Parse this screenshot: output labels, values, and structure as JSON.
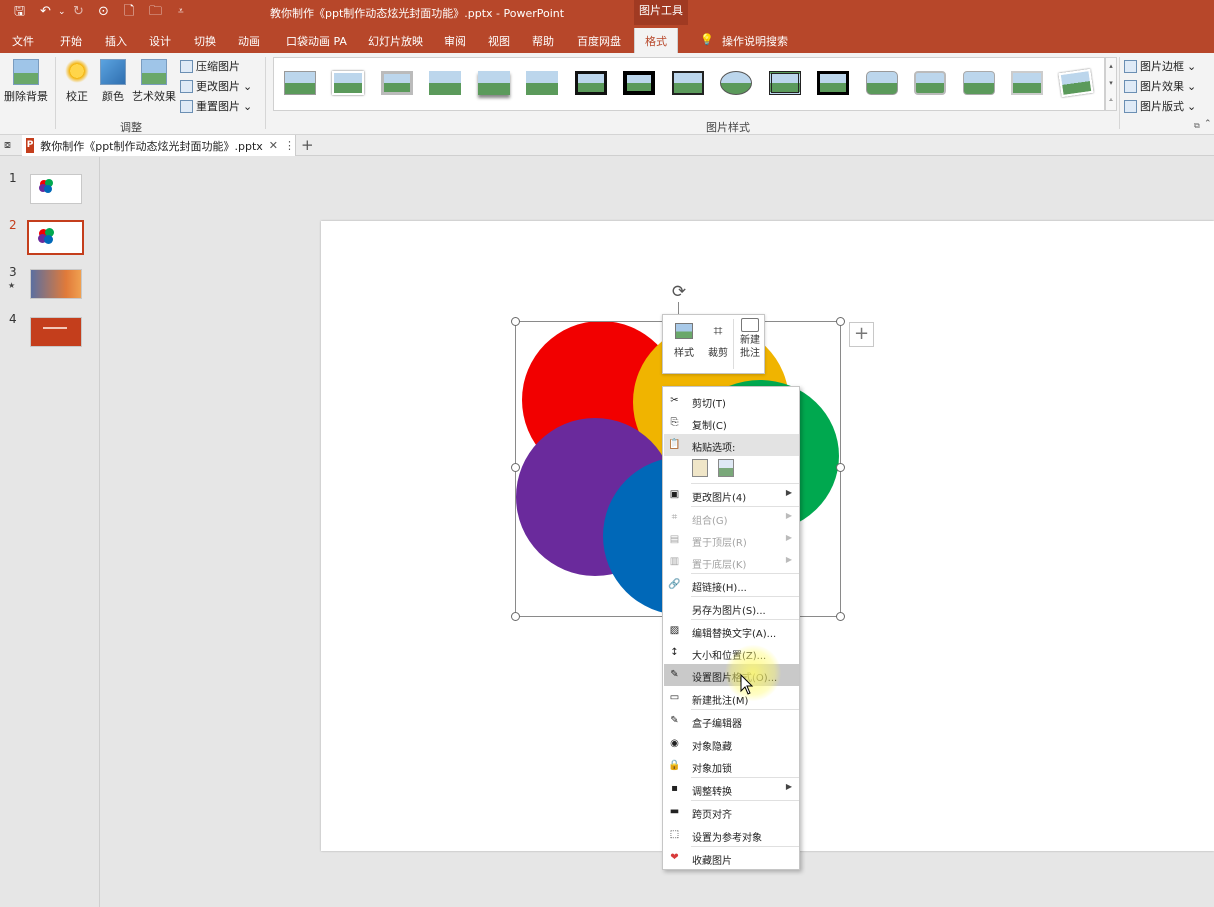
{
  "window": {
    "title": "教你制作《ppt制作动态炫光封面功能》.pptx  -  PowerPoint",
    "context_tool": "图片工具"
  },
  "qat": {
    "save": "🖫",
    "undo": "↶",
    "undo_drop": "⌄",
    "redo": "↻",
    "p1": "⊙",
    "new": "🗋",
    "open": "🗀",
    "more": "⩡"
  },
  "tabs": [
    "文件",
    "开始",
    "插入",
    "设计",
    "切换",
    "动画",
    "口袋动画 PA",
    "幻灯片放映",
    "审阅",
    "视图",
    "帮助",
    "百度网盘",
    "格式"
  ],
  "active_tab": "格式",
  "tell_me": "操作说明搜索",
  "ribbon": {
    "remove_bg": "删除背景",
    "correct": "校正",
    "color": "颜色",
    "artistic": "艺术效果",
    "compress": "压缩图片",
    "change": "更改图片",
    "reset": "重置图片",
    "adjust_group": "调整",
    "style_group": "图片样式",
    "border": "图片边框",
    "effects": "图片效果",
    "layout": "图片版式"
  },
  "doc_tab": {
    "name": "教你制作《ppt制作动态炫光封面功能》.pptx",
    "close": "✕",
    "more": "⋮",
    "add": "+"
  },
  "slides": [
    {
      "num": "1"
    },
    {
      "num": "2"
    },
    {
      "num": "3",
      "star": "★"
    },
    {
      "num": "4"
    }
  ],
  "colors": {
    "red": "#f20000",
    "yellow": "#f0b400",
    "green": "#00a84f",
    "purple": "#6a2a9c",
    "blue": "#0068b8",
    "accent": "#b7472a"
  },
  "mini_toolbar": {
    "style": "样式",
    "crop": "裁剪",
    "comment_line1": "新建",
    "comment_line2": "批注"
  },
  "context_menu": [
    {
      "label": "剪切(T)",
      "icon": "✂"
    },
    {
      "label": "复制(C)",
      "icon": "⎘"
    },
    {
      "label": "粘贴选项:",
      "icon": "📋"
    },
    {
      "label": "",
      "icon": ""
    },
    {
      "label": "更改图片(4)",
      "icon": "▣"
    },
    {
      "label": "组合(G)",
      "icon": "⌗"
    },
    {
      "label": "置于顶层(R)",
      "icon": "▤"
    },
    {
      "label": "置于底层(K)",
      "icon": "▥"
    },
    {
      "label": "超链接(H)...",
      "icon": "🔗"
    },
    {
      "label": "另存为图片(S)...",
      "icon": ""
    },
    {
      "label": "编辑替换文字(A)...",
      "icon": "▨"
    },
    {
      "label": "大小和位置(Z)...",
      "icon": "↕"
    },
    {
      "label": "设置图片格式(O)...",
      "icon": "✎"
    },
    {
      "label": "新建批注(M)",
      "icon": "▭"
    },
    {
      "label": "盒子编辑器",
      "icon": "✎"
    },
    {
      "label": "对象隐藏",
      "icon": "◉"
    },
    {
      "label": "对象加锁",
      "icon": "🔒"
    },
    {
      "label": "调整转换",
      "icon": "▪"
    },
    {
      "label": "跨页对齐",
      "icon": "▬"
    },
    {
      "label": "设置为参考对象",
      "icon": "⬚"
    },
    {
      "label": "收藏图片",
      "icon": "❤"
    }
  ]
}
